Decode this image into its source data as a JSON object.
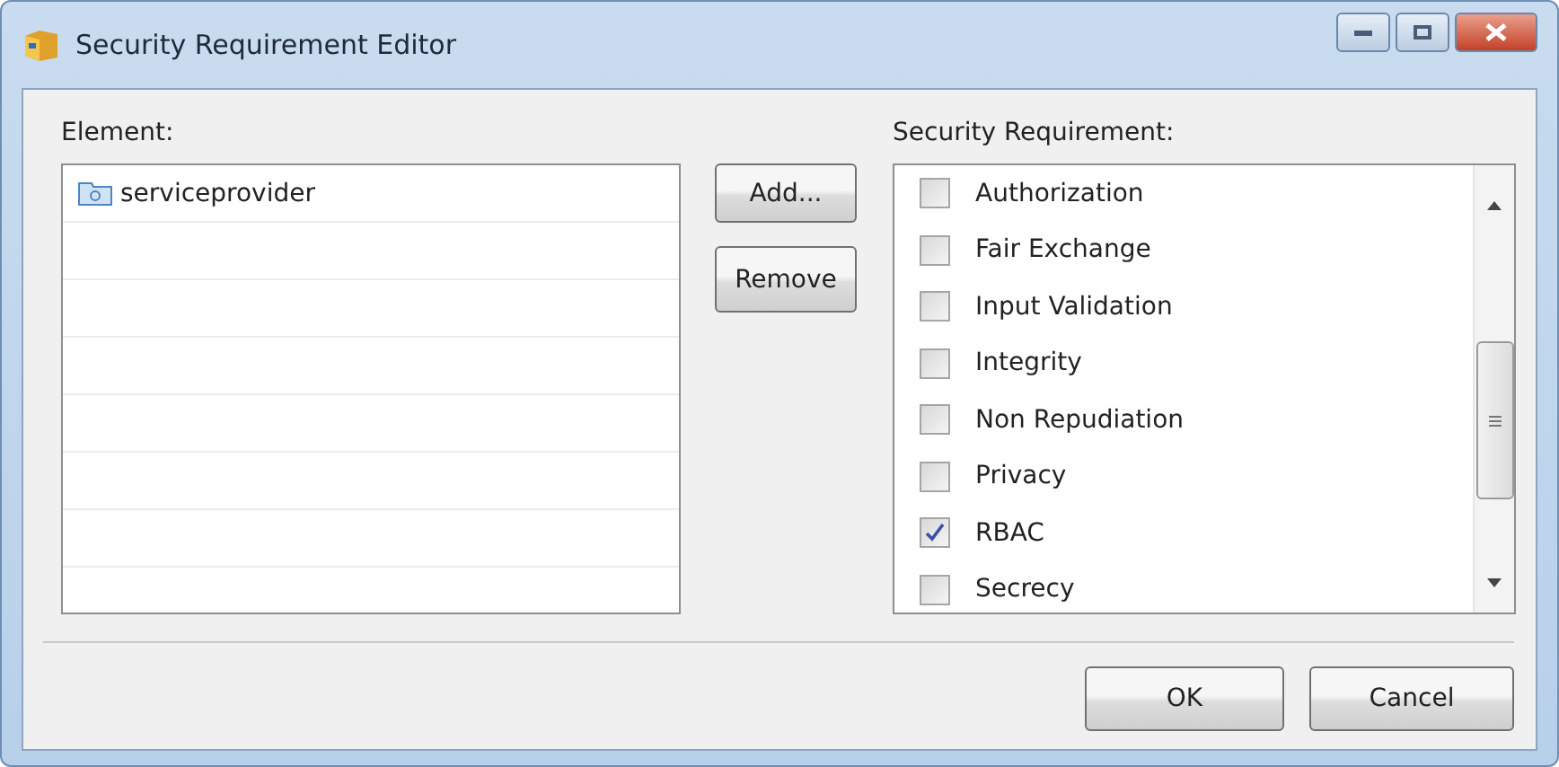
{
  "window": {
    "title": "Security Requirement Editor"
  },
  "element": {
    "label": "Element:",
    "items": [
      {
        "name": "serviceprovider",
        "selected": false
      }
    ]
  },
  "buttons": {
    "add": "Add...",
    "remove": "Remove"
  },
  "requirements": {
    "label": "Security Requirement:",
    "items": [
      {
        "name": "Authorization",
        "checked": false
      },
      {
        "name": "Fair Exchange",
        "checked": false
      },
      {
        "name": "Input Validation",
        "checked": false
      },
      {
        "name": "Integrity",
        "checked": false
      },
      {
        "name": "Non Repudiation",
        "checked": false
      },
      {
        "name": "Privacy",
        "checked": false
      },
      {
        "name": "RBAC",
        "checked": true
      },
      {
        "name": "Secrecy",
        "checked": false
      }
    ]
  },
  "footer": {
    "ok": "OK",
    "cancel": "Cancel"
  }
}
